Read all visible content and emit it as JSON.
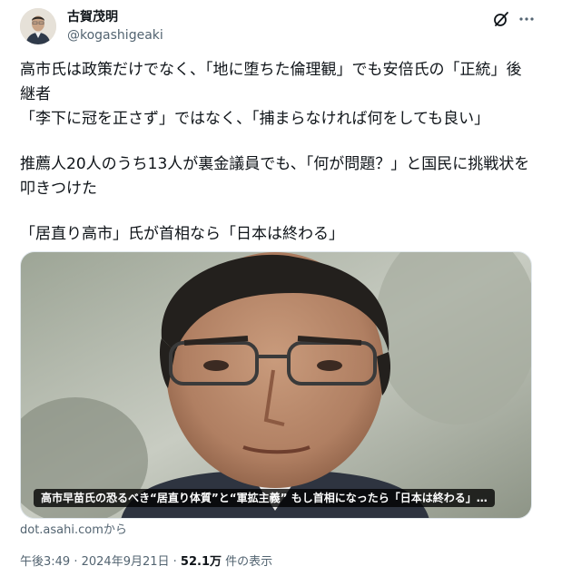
{
  "author": {
    "name": "古賀茂明",
    "handle": "@kogashigeaki"
  },
  "icons": {
    "grok": "grok-icon",
    "more": "more-icon"
  },
  "tweet": {
    "lines": [
      "高市氏は政策だけでなく、「地に堕ちた倫理観」でも安倍氏の「正統」後",
      "継者",
      "「李下に冠を正さず」ではなく、「捕まらなければ何をしても良い」",
      "推薦人20人のうち13人が裏金議員でも、「何が問題？」と国民に挑戦状を",
      "叩きつけた",
      "「居直り高市」氏が首相なら「日本は終わる」"
    ]
  },
  "card": {
    "caption": "高市早苗氏の恐るべき“居直り体質”と“軍拡主義” もし首相になったら「日本は終わる」…",
    "source": "dot.asahi.comから"
  },
  "meta": {
    "time": "午後3:49",
    "separator": " · ",
    "date": "2024年9月21日",
    "separator2": " · ",
    "views_count": "52.1万",
    "views_label": " 件の表示"
  },
  "colors": {
    "text_primary": "#0f1419",
    "text_secondary": "#536471",
    "border": "#e1e8ed"
  }
}
